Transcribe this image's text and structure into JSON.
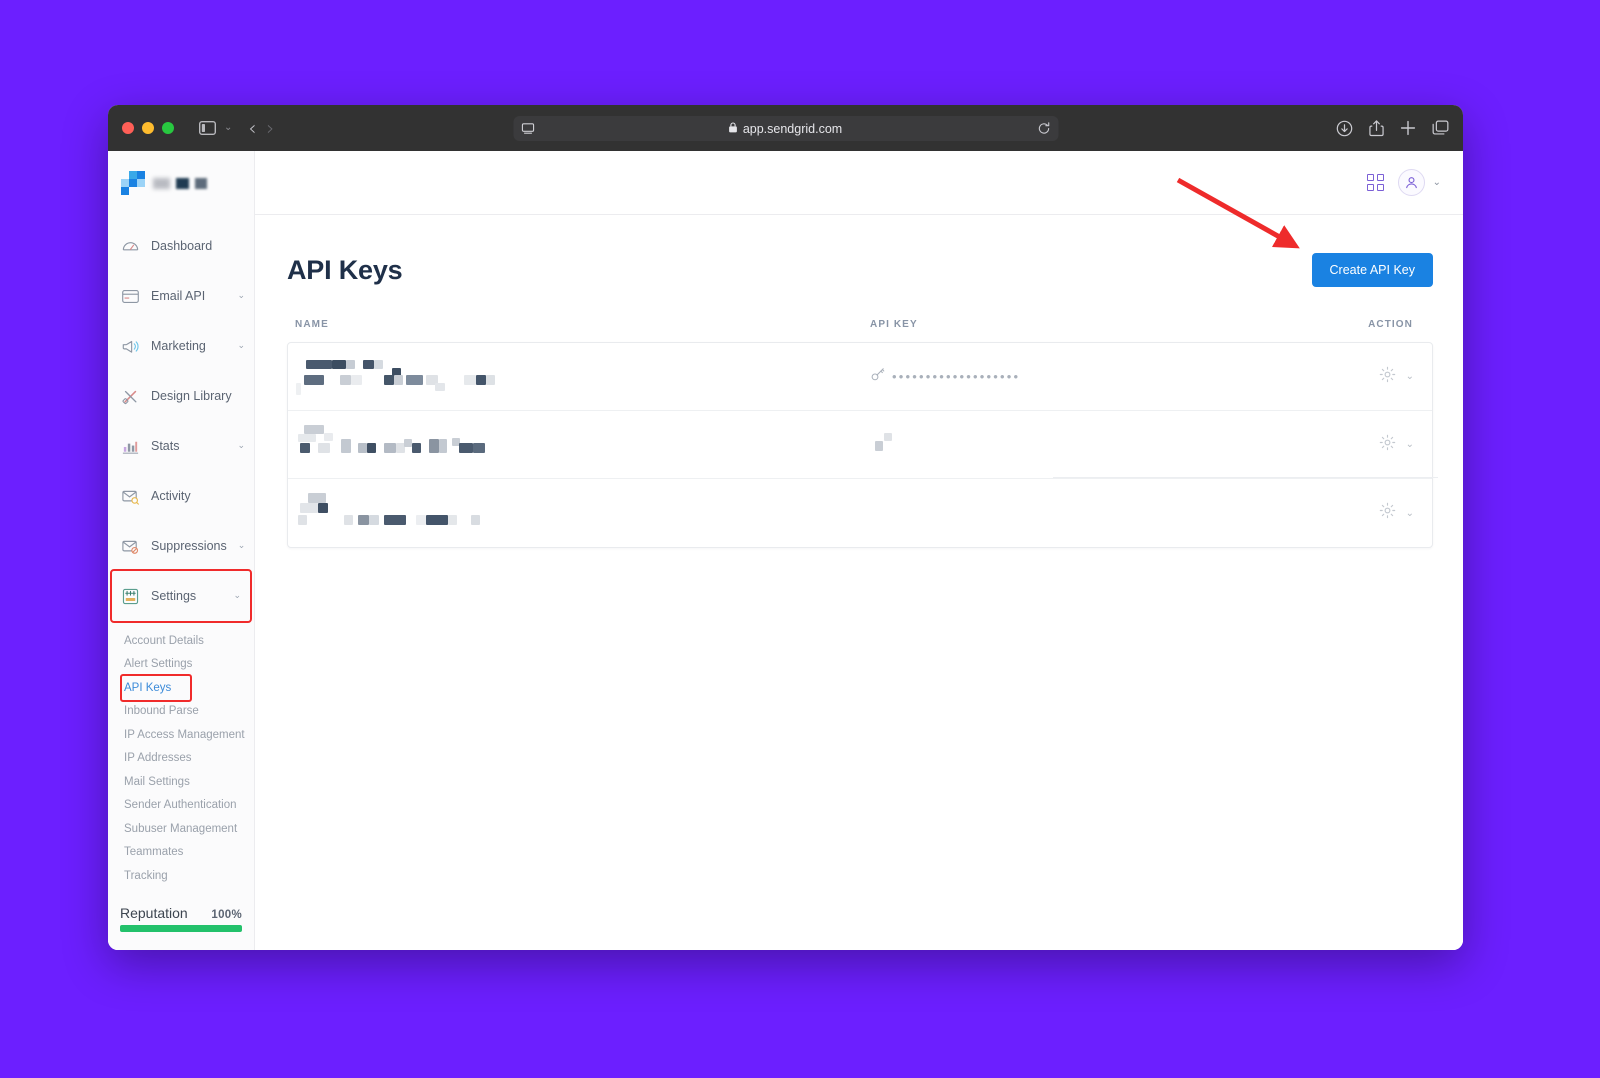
{
  "browser": {
    "url": "app.sendgrid.com",
    "lock_icon": "lock-icon",
    "sidebar_toggle_icon": "sidebar-toggle-icon",
    "back_icon": "chevron-left-icon",
    "forward_icon": "chevron-right-icon",
    "reader_icon": "reader-view-icon",
    "reload_icon": "reload-icon",
    "downloads_icon": "downloads-icon",
    "share_icon": "share-icon",
    "new_tab_icon": "plus-icon",
    "tabs_icon": "tab-overview-icon"
  },
  "sidebar": {
    "logo_name": "sendgrid-logo",
    "items": [
      {
        "label": "Dashboard",
        "icon": "gauge-icon",
        "expandable": false
      },
      {
        "label": "Email API",
        "icon": "window-icon",
        "expandable": true
      },
      {
        "label": "Marketing",
        "icon": "megaphone-icon",
        "expandable": true
      },
      {
        "label": "Design Library",
        "icon": "brush-icon",
        "expandable": false
      },
      {
        "label": "Stats",
        "icon": "bar-chart-icon",
        "expandable": true
      },
      {
        "label": "Activity",
        "icon": "envelope-search-icon",
        "expandable": false
      },
      {
        "label": "Suppressions",
        "icon": "envelope-blocked-icon",
        "expandable": true
      }
    ],
    "settings": {
      "label": "Settings",
      "icon": "settings-sliders-icon",
      "expandable": true,
      "highlighted": true,
      "highlight_color": "#F02B2B"
    },
    "sub_items": [
      {
        "label": "Account Details",
        "active": false
      },
      {
        "label": "Alert Settings",
        "active": false
      },
      {
        "label": "API Keys",
        "active": true,
        "highlighted": true
      },
      {
        "label": "Inbound Parse",
        "active": false
      },
      {
        "label": "IP Access Management",
        "active": false
      },
      {
        "label": "IP Addresses",
        "active": false
      },
      {
        "label": "Mail Settings",
        "active": false
      },
      {
        "label": "Sender Authentication",
        "active": false
      },
      {
        "label": "Subuser Management",
        "active": false
      },
      {
        "label": "Teammates",
        "active": false
      },
      {
        "label": "Tracking",
        "active": false
      }
    ],
    "reputation": {
      "label": "Reputation",
      "value": "100%",
      "percent": 100,
      "bar_color": "#23C16B"
    }
  },
  "topbar": {
    "apps_icon": "grid-apps-icon",
    "avatar_icon": "user-avatar-icon",
    "avatar_caret_icon": "chevron-down-icon"
  },
  "page": {
    "title": "API Keys",
    "create_button": {
      "label": "Create API Key",
      "color": "#1A82E2"
    }
  },
  "table": {
    "columns": [
      "NAME",
      "API KEY",
      "ACTION"
    ],
    "rows": [
      {
        "name": "",
        "name_redacted": true,
        "api_key_icon": "key-icon",
        "api_key_masked": "•••••••••••••••••••",
        "action_icons": [
          "gear-icon",
          "chevron-down-icon"
        ]
      },
      {
        "name": "",
        "name_redacted": true,
        "api_key_icon": "",
        "api_key_masked": "",
        "action_icons": [
          "gear-icon",
          "chevron-down-icon"
        ]
      },
      {
        "name": "",
        "name_redacted": true,
        "api_key_icon": "",
        "api_key_masked": "",
        "action_icons": [
          "gear-icon",
          "chevron-down-icon"
        ]
      }
    ]
  },
  "annotations": {
    "arrow": {
      "name": "red-arrow-annotation",
      "color": "#EE2B2B",
      "points_to": "create-api-key-button"
    },
    "boxes": [
      {
        "target": "settings-nav-item",
        "color": "#F02B2B"
      },
      {
        "target": "api-keys-sub-item",
        "color": "#F02B2B"
      }
    ]
  },
  "background": {
    "color": "#6C1FFF"
  }
}
